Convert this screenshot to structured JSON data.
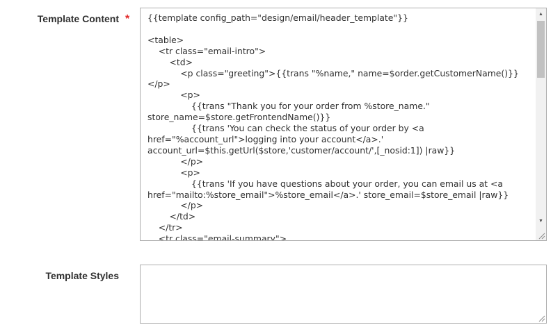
{
  "form": {
    "template_content": {
      "label": "Template Content",
      "required_marker": "*",
      "value": "{{template config_path=\"design/email/header_template\"}}\n\n<table>\n    <tr class=\"email-intro\">\n        <td>\n            <p class=\"greeting\">{{trans \"%name,\" name=$order.getCustomerName()}}</p>\n            <p>\n                {{trans \"Thank you for your order from %store_name.\" store_name=$store.getFrontendName()}}\n                {{trans 'You can check the status of your order by <a href=\"%account_url\">logging into your account</a>.' account_url=$this.getUrl($store,'customer/account/',[_nosid:1]) |raw}}\n            </p>\n            <p>\n                {{trans 'If you have questions about your order, you can email us at <a href=\"mailto:%store_email\">%store_email</a>.' store_email=$store_email |raw}}\n            </p>\n        </td>\n    </tr>\n    <tr class=\"email-summary\">"
    },
    "template_styles": {
      "label": "Template Styles",
      "value": ""
    }
  },
  "colors": {
    "required": "#e22626",
    "border": "#adadad",
    "label": "#303030"
  }
}
